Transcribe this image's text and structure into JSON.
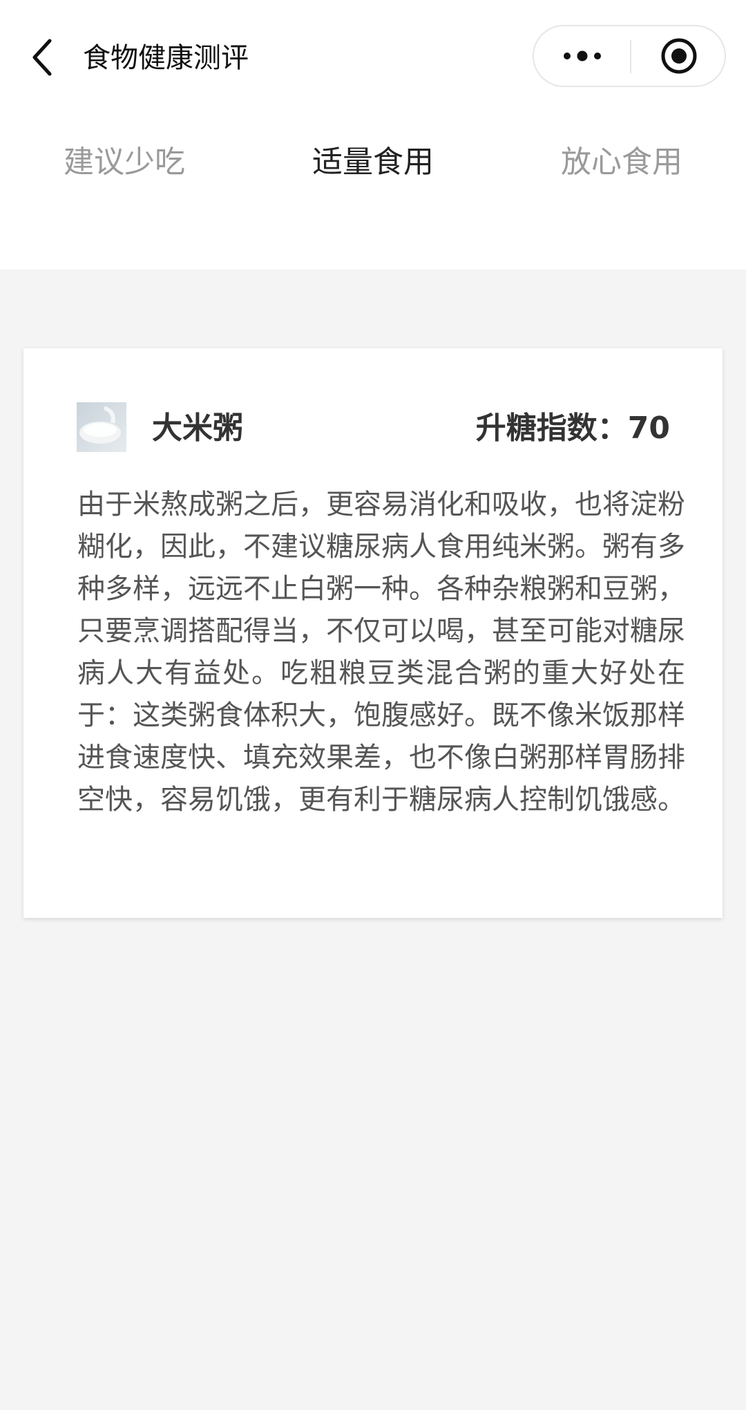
{
  "nav": {
    "title": "食物健康测评",
    "icons": {
      "back": "chevron-left-icon",
      "more": "more-dots-icon",
      "close": "target-circle-icon"
    }
  },
  "tabs": [
    {
      "label": "建议少吃",
      "active": false
    },
    {
      "label": "适量食用",
      "active": true
    },
    {
      "label": "放心食用",
      "active": false
    }
  ],
  "food": {
    "name": "大米粥",
    "gi_label": "升糖指数：70",
    "description": "由于米熬成粥之后，更容易消化和吸收，也将淀粉糊化，因此，不建议糖尿病人食用纯米粥。粥有多种多样，远远不止白粥一种。各种杂粮粥和豆粥，只要烹调搭配得当，不仅可以喝，甚至可能对糖尿病人大有益处。吃粗粮豆类混合粥的重大好处在于：这类粥食体积大，饱腹感好。既不像米饭那样进食速度快、填充效果差，也不像白粥那样胃肠排空快，容易饥饿，更有利于糖尿病人控制饥饿感。"
  },
  "colors": {
    "page_bg": "#f4f4f4",
    "header_bg": "#ffffff",
    "tab_inactive": "#9a9a9a",
    "tab_active": "#222222",
    "text_body": "#555555",
    "text_title": "#333333"
  }
}
